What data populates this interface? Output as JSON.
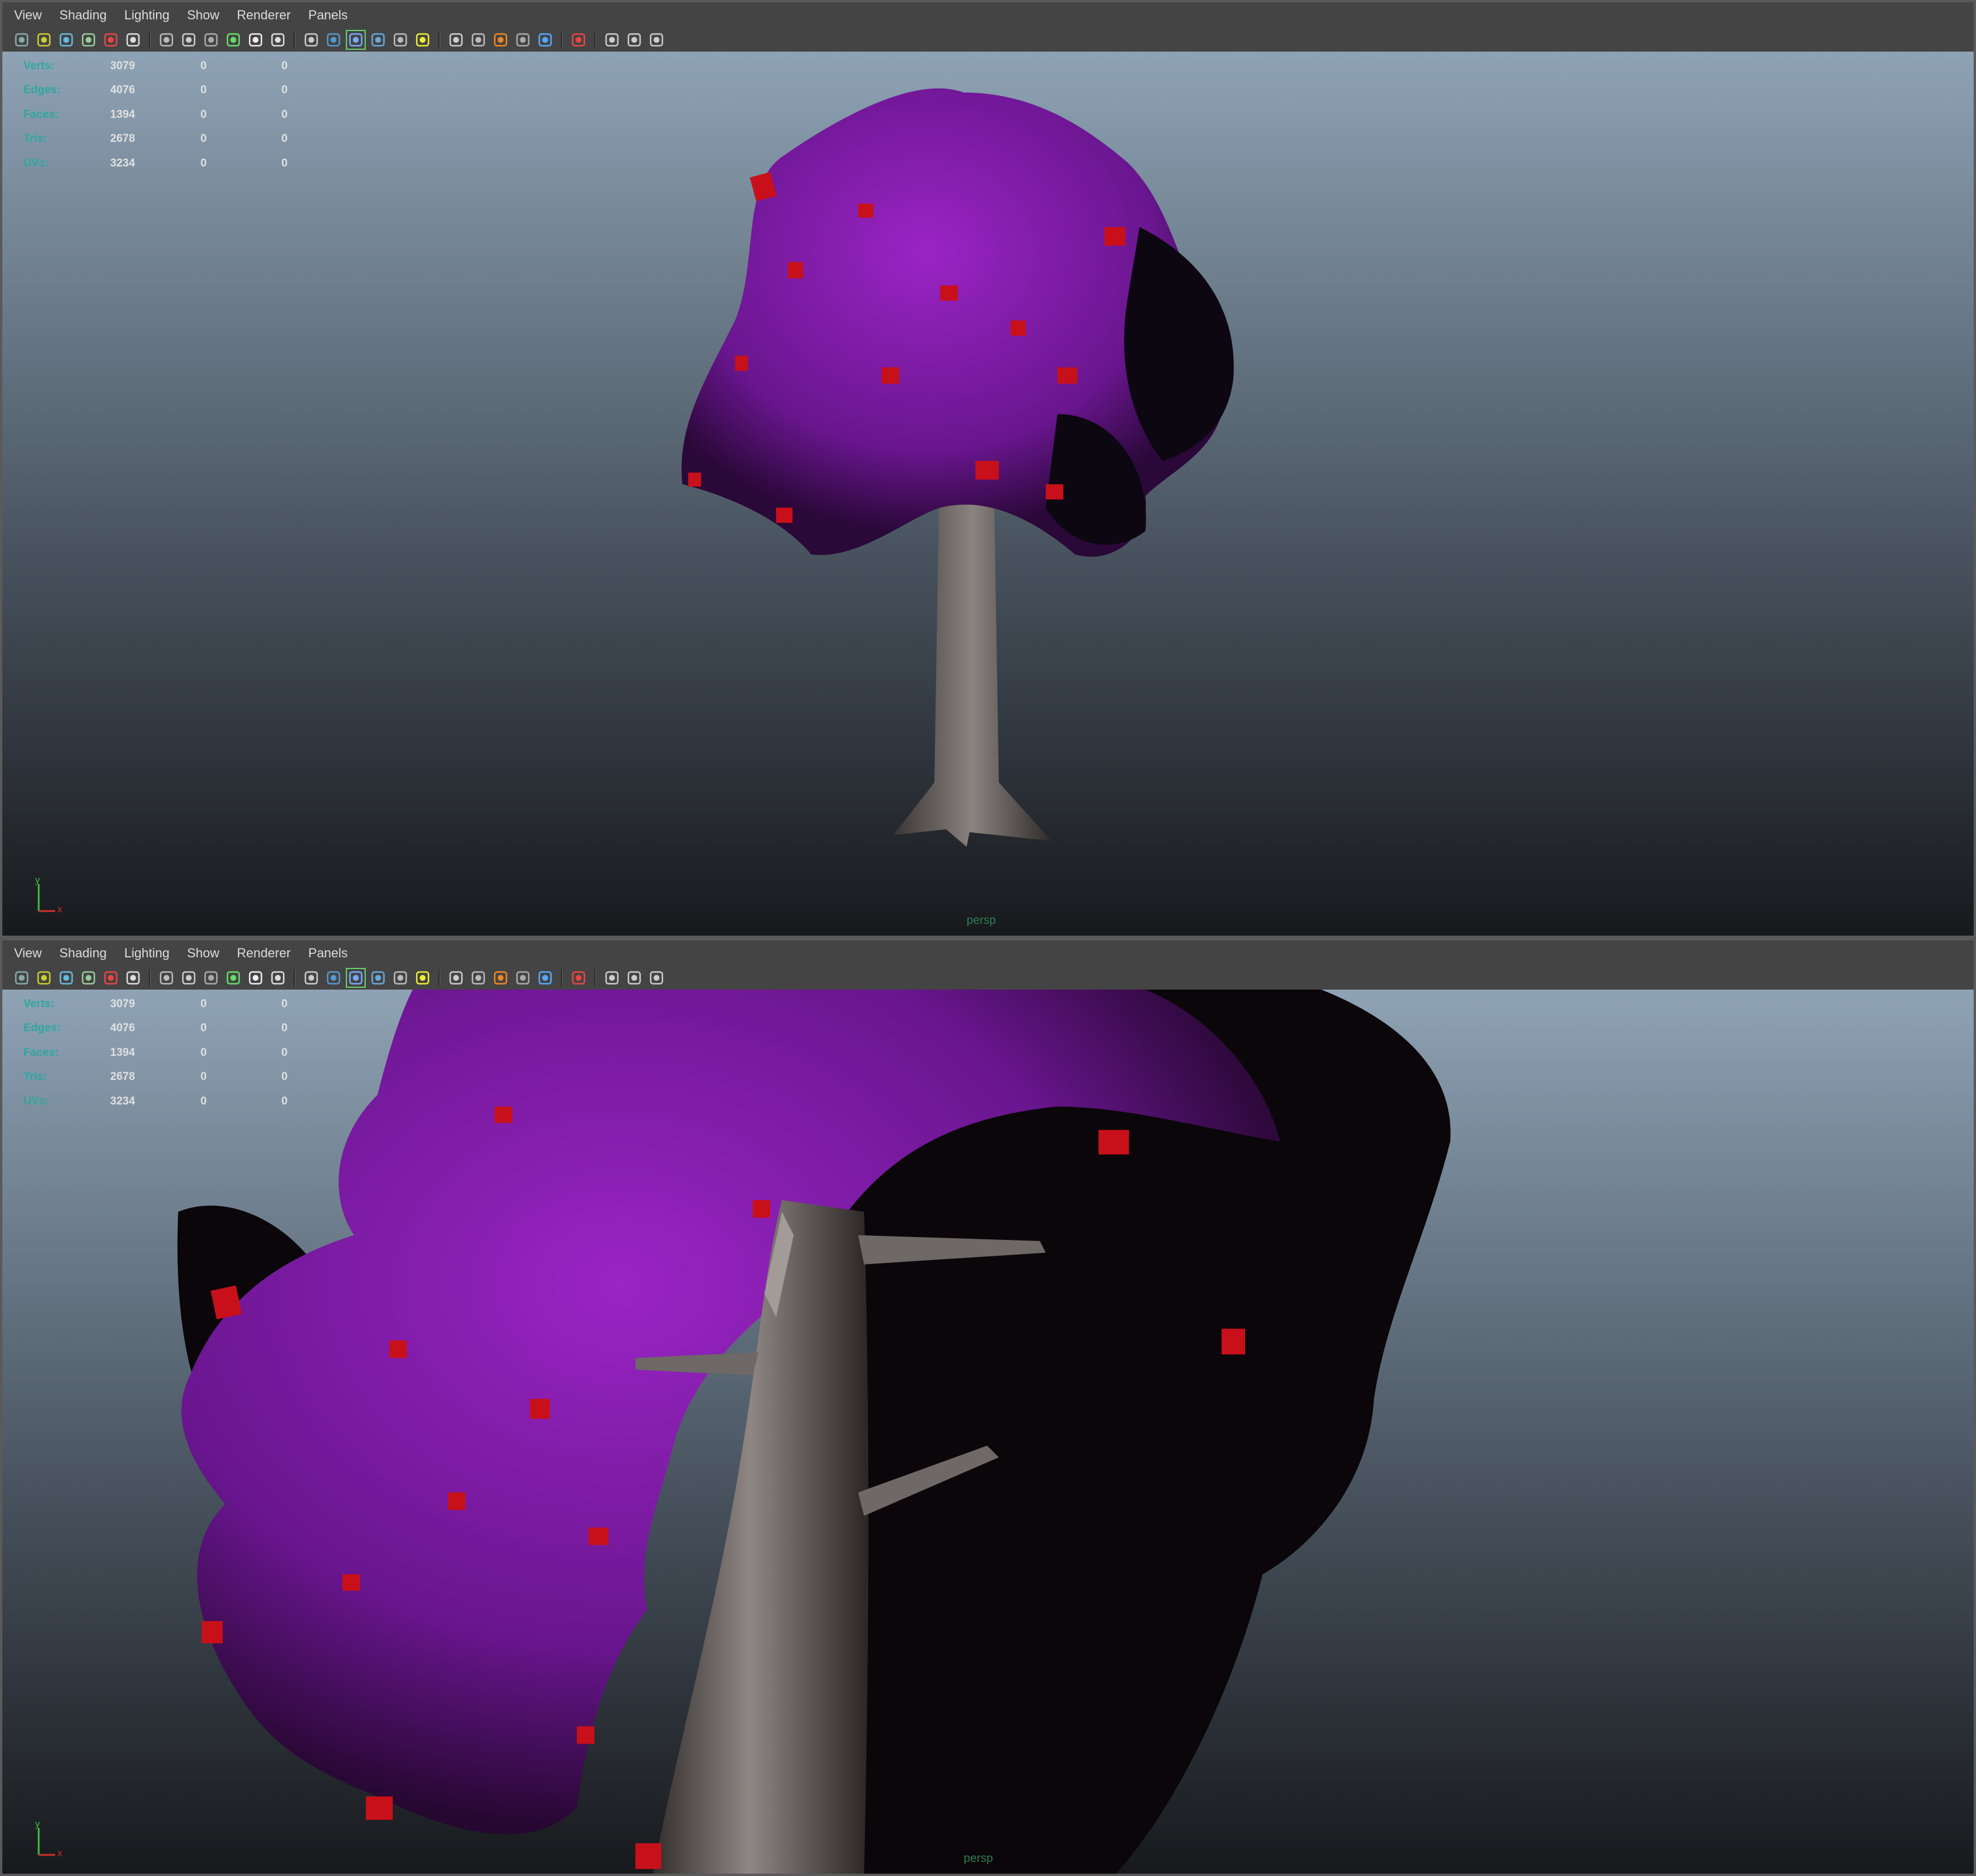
{
  "menu": [
    "View",
    "Shading",
    "Lighting",
    "Show",
    "Renderer",
    "Panels"
  ],
  "hud": [
    {
      "label": "Verts:",
      "value": "3079",
      "sel": "0",
      "sel2": "0"
    },
    {
      "label": "Edges:",
      "value": "4076",
      "sel": "0",
      "sel2": "0"
    },
    {
      "label": "Faces:",
      "value": "1394",
      "sel": "0",
      "sel2": "0"
    },
    {
      "label": "Tris:",
      "value": "2678",
      "sel": "0",
      "sel2": "0"
    },
    {
      "label": "UVs:",
      "value": "3234",
      "sel": "0",
      "sel2": "0"
    }
  ],
  "camera_label": "persp",
  "axis": {
    "y": "y",
    "x": "x"
  },
  "colors": {
    "leaf": "#7a1a9c",
    "fruit": "#c8101a",
    "trunk": "#7b7370",
    "bg_top": "#8ea3b5",
    "bg_bottom": "#16181b",
    "hud_label": "#2fa7a0"
  },
  "toolbar_icons": [
    "camera-select-icon",
    "camera-attrs-icon",
    "bookmark-icon",
    "image-plane-icon",
    "2d-pan-icon",
    "grease-pencil-icon",
    "grid-icon",
    "film-gate-icon",
    "resolution-gate-icon",
    "gate-mask-icon",
    "field-chart-icon",
    "safe-title-icon",
    "wireframe-icon",
    "smooth-shade-icon",
    "shade-wire-icon",
    "xray-icon",
    "textured-icon",
    "use-lights-icon",
    "shadows-icon",
    "ambient-occlusion-icon",
    "motion-blur-icon",
    "anti-alias-icon",
    "depth-of-field-icon",
    "isolate-select-icon",
    "xray-joints-icon",
    "xray-active-icon",
    "hypershade-icon"
  ]
}
